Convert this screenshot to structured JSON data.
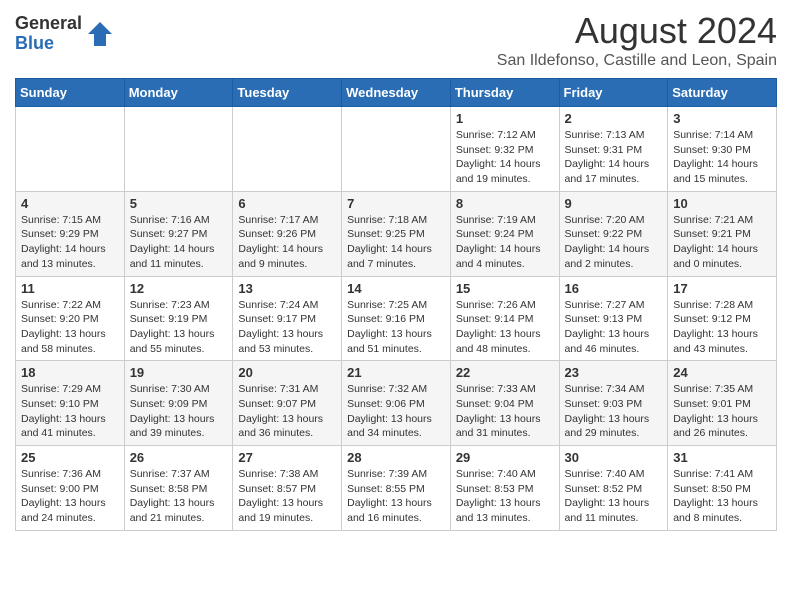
{
  "logo": {
    "general": "General",
    "blue": "Blue"
  },
  "title": "August 2024",
  "subtitle": "San Ildefonso, Castille and Leon, Spain",
  "weekdays": [
    "Sunday",
    "Monday",
    "Tuesday",
    "Wednesday",
    "Thursday",
    "Friday",
    "Saturday"
  ],
  "weeks": [
    [
      {
        "day": "",
        "info": ""
      },
      {
        "day": "",
        "info": ""
      },
      {
        "day": "",
        "info": ""
      },
      {
        "day": "",
        "info": ""
      },
      {
        "day": "1",
        "info": "Sunrise: 7:12 AM\nSunset: 9:32 PM\nDaylight: 14 hours and 19 minutes."
      },
      {
        "day": "2",
        "info": "Sunrise: 7:13 AM\nSunset: 9:31 PM\nDaylight: 14 hours and 17 minutes."
      },
      {
        "day": "3",
        "info": "Sunrise: 7:14 AM\nSunset: 9:30 PM\nDaylight: 14 hours and 15 minutes."
      }
    ],
    [
      {
        "day": "4",
        "info": "Sunrise: 7:15 AM\nSunset: 9:29 PM\nDaylight: 14 hours and 13 minutes."
      },
      {
        "day": "5",
        "info": "Sunrise: 7:16 AM\nSunset: 9:27 PM\nDaylight: 14 hours and 11 minutes."
      },
      {
        "day": "6",
        "info": "Sunrise: 7:17 AM\nSunset: 9:26 PM\nDaylight: 14 hours and 9 minutes."
      },
      {
        "day": "7",
        "info": "Sunrise: 7:18 AM\nSunset: 9:25 PM\nDaylight: 14 hours and 7 minutes."
      },
      {
        "day": "8",
        "info": "Sunrise: 7:19 AM\nSunset: 9:24 PM\nDaylight: 14 hours and 4 minutes."
      },
      {
        "day": "9",
        "info": "Sunrise: 7:20 AM\nSunset: 9:22 PM\nDaylight: 14 hours and 2 minutes."
      },
      {
        "day": "10",
        "info": "Sunrise: 7:21 AM\nSunset: 9:21 PM\nDaylight: 14 hours and 0 minutes."
      }
    ],
    [
      {
        "day": "11",
        "info": "Sunrise: 7:22 AM\nSunset: 9:20 PM\nDaylight: 13 hours and 58 minutes."
      },
      {
        "day": "12",
        "info": "Sunrise: 7:23 AM\nSunset: 9:19 PM\nDaylight: 13 hours and 55 minutes."
      },
      {
        "day": "13",
        "info": "Sunrise: 7:24 AM\nSunset: 9:17 PM\nDaylight: 13 hours and 53 minutes."
      },
      {
        "day": "14",
        "info": "Sunrise: 7:25 AM\nSunset: 9:16 PM\nDaylight: 13 hours and 51 minutes."
      },
      {
        "day": "15",
        "info": "Sunrise: 7:26 AM\nSunset: 9:14 PM\nDaylight: 13 hours and 48 minutes."
      },
      {
        "day": "16",
        "info": "Sunrise: 7:27 AM\nSunset: 9:13 PM\nDaylight: 13 hours and 46 minutes."
      },
      {
        "day": "17",
        "info": "Sunrise: 7:28 AM\nSunset: 9:12 PM\nDaylight: 13 hours and 43 minutes."
      }
    ],
    [
      {
        "day": "18",
        "info": "Sunrise: 7:29 AM\nSunset: 9:10 PM\nDaylight: 13 hours and 41 minutes."
      },
      {
        "day": "19",
        "info": "Sunrise: 7:30 AM\nSunset: 9:09 PM\nDaylight: 13 hours and 39 minutes."
      },
      {
        "day": "20",
        "info": "Sunrise: 7:31 AM\nSunset: 9:07 PM\nDaylight: 13 hours and 36 minutes."
      },
      {
        "day": "21",
        "info": "Sunrise: 7:32 AM\nSunset: 9:06 PM\nDaylight: 13 hours and 34 minutes."
      },
      {
        "day": "22",
        "info": "Sunrise: 7:33 AM\nSunset: 9:04 PM\nDaylight: 13 hours and 31 minutes."
      },
      {
        "day": "23",
        "info": "Sunrise: 7:34 AM\nSunset: 9:03 PM\nDaylight: 13 hours and 29 minutes."
      },
      {
        "day": "24",
        "info": "Sunrise: 7:35 AM\nSunset: 9:01 PM\nDaylight: 13 hours and 26 minutes."
      }
    ],
    [
      {
        "day": "25",
        "info": "Sunrise: 7:36 AM\nSunset: 9:00 PM\nDaylight: 13 hours and 24 minutes."
      },
      {
        "day": "26",
        "info": "Sunrise: 7:37 AM\nSunset: 8:58 PM\nDaylight: 13 hours and 21 minutes."
      },
      {
        "day": "27",
        "info": "Sunrise: 7:38 AM\nSunset: 8:57 PM\nDaylight: 13 hours and 19 minutes."
      },
      {
        "day": "28",
        "info": "Sunrise: 7:39 AM\nSunset: 8:55 PM\nDaylight: 13 hours and 16 minutes."
      },
      {
        "day": "29",
        "info": "Sunrise: 7:40 AM\nSunset: 8:53 PM\nDaylight: 13 hours and 13 minutes."
      },
      {
        "day": "30",
        "info": "Sunrise: 7:40 AM\nSunset: 8:52 PM\nDaylight: 13 hours and 11 minutes."
      },
      {
        "day": "31",
        "info": "Sunrise: 7:41 AM\nSunset: 8:50 PM\nDaylight: 13 hours and 8 minutes."
      }
    ]
  ]
}
